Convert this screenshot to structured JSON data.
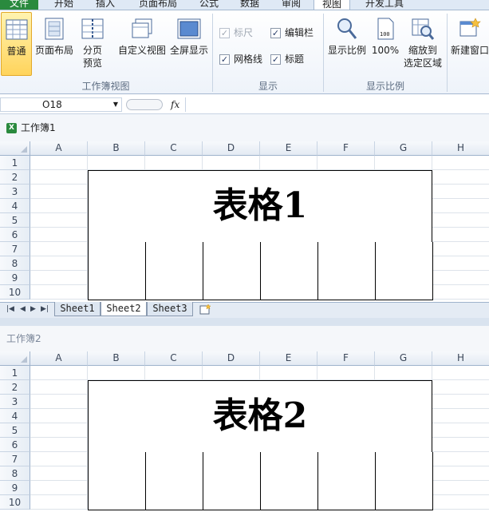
{
  "tabs": [
    {
      "label": "文件"
    },
    {
      "label": "开始"
    },
    {
      "label": "插入"
    },
    {
      "label": "页面布局"
    },
    {
      "label": "公式"
    },
    {
      "label": "数据"
    },
    {
      "label": "审阅"
    },
    {
      "label": "视图"
    },
    {
      "label": "开发工具"
    }
  ],
  "ribbon": {
    "views_group": {
      "label": "工作簿视图",
      "normal": "普通",
      "page_layout": "页面布局",
      "page_break_1": "分页",
      "page_break_2": "预览",
      "custom_view": "自定义视图",
      "full_screen": "全屏显示"
    },
    "show_group": {
      "label": "显示",
      "ruler": "标尺",
      "formula_bar": "编辑栏",
      "gridlines": "网格线",
      "headings": "标题"
    },
    "zoom_group": {
      "label": "显示比例",
      "zoom": "显示比例",
      "hundred": "100%",
      "zoom_sel_1": "缩放到",
      "zoom_sel_2": "选定区域",
      "hundred_icon_text": "100"
    },
    "window_group": {
      "new_window": "新建窗口"
    }
  },
  "formula_bar": {
    "name_box": "O18",
    "fx": "fx",
    "formula": ""
  },
  "columns": [
    "A",
    "B",
    "C",
    "D",
    "E",
    "F",
    "G",
    "H"
  ],
  "rows": [
    "1",
    "2",
    "3",
    "4",
    "5",
    "6",
    "7",
    "8",
    "9",
    "10"
  ],
  "workbook1": {
    "title": "工作簿1",
    "table_title": "表格1",
    "sheets": [
      "Sheet1",
      "Sheet2",
      "Sheet3"
    ],
    "active_sheet": "Sheet2"
  },
  "workbook2": {
    "title": "工作簿2",
    "table_title": "表格2"
  },
  "colors": {
    "file_tab": "#2a8a3e",
    "ribbon_active": "#ffd45c",
    "header_bg": "#e3eaf3"
  }
}
